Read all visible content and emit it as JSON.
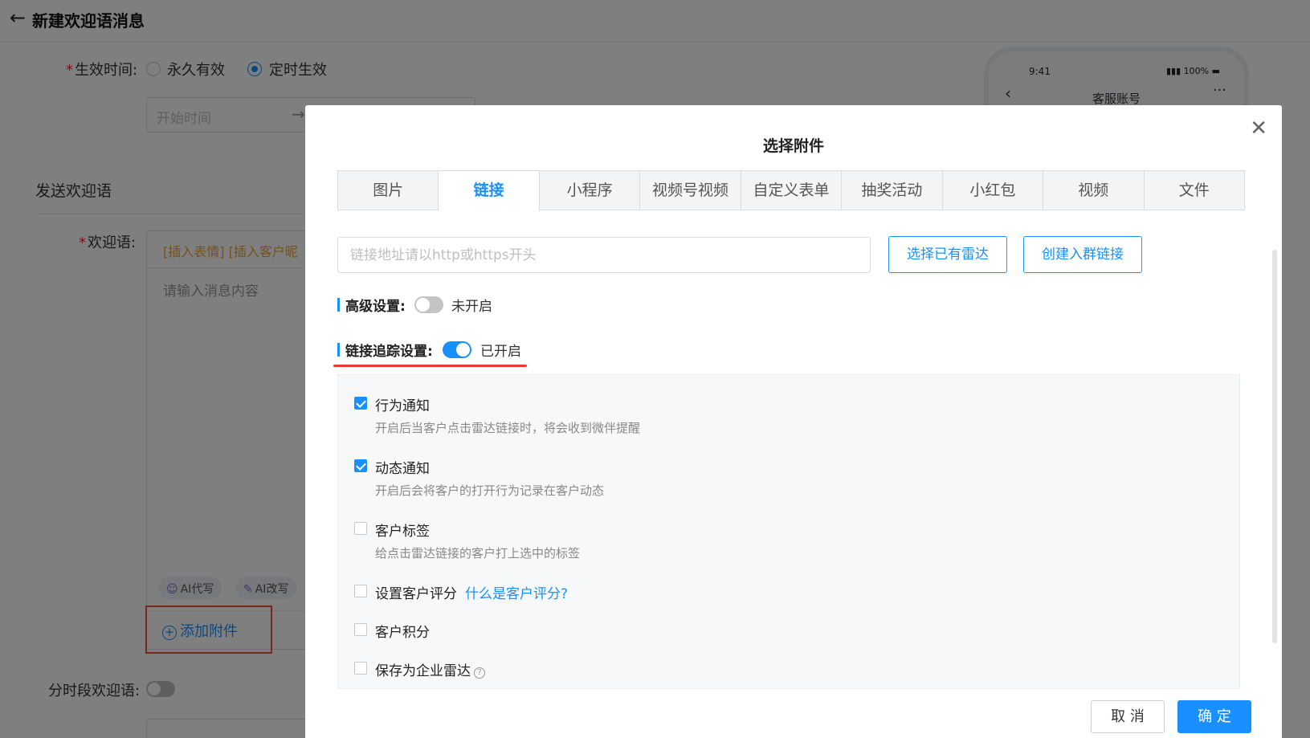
{
  "page": {
    "title": "新建欢迎语消息",
    "effective_time": {
      "label": "生效时间:",
      "options": [
        "永久有效",
        "定时生效"
      ],
      "selected": "定时生效",
      "start_placeholder": "开始时间"
    },
    "section_title": "发送欢迎语",
    "welcome": {
      "label": "欢迎语:",
      "toolbar_links": "[插入表情] [插入客户昵",
      "placeholder": "请输入消息内容",
      "ai_write": "AI代写",
      "ai_rewrite": "AI改写",
      "add_attachment": "添加附件"
    },
    "timed_welcome_label": "分时段欢迎语:",
    "phone": {
      "time": "9:41",
      "battery": "100%",
      "title": "客服账号"
    }
  },
  "modal": {
    "title": "选择附件",
    "tabs": [
      "图片",
      "链接",
      "小程序",
      "视频号视频",
      "自定义表单",
      "抽奖活动",
      "小红包",
      "视频",
      "文件"
    ],
    "active_tab": "链接",
    "url_placeholder": "链接地址请以http或https开头",
    "select_radar_button": "选择已有雷达",
    "create_group_link_button": "创建入群链接",
    "advanced": {
      "label": "高级设置:",
      "state_text": "未开启",
      "enabled": false
    },
    "tracking": {
      "label": "链接追踪设置:",
      "state_text": "已开启",
      "enabled": true
    },
    "options": [
      {
        "label": "行为通知",
        "desc": "开启后当客户点击雷达链接时，将会收到微伴提醒",
        "checked": true
      },
      {
        "label": "动态通知",
        "desc": "开启后会将客户的打开行为记录在客户动态",
        "checked": true
      },
      {
        "label": "客户标签",
        "desc": "给点击雷达链接的客户打上选中的标签",
        "checked": false
      },
      {
        "label": "设置客户评分",
        "link": "什么是客户评分?",
        "checked": false
      },
      {
        "label": "客户积分",
        "checked": false
      },
      {
        "label": "保存为企业雷达",
        "help": "?",
        "checked": false
      }
    ],
    "cancel_button": "取 消",
    "ok_button": "确 定"
  },
  "colors": {
    "primary": "#1890ff",
    "required": "#f5222d",
    "highlight": "#e53935",
    "overlay": "rgba(0,0,0,0.5)"
  }
}
